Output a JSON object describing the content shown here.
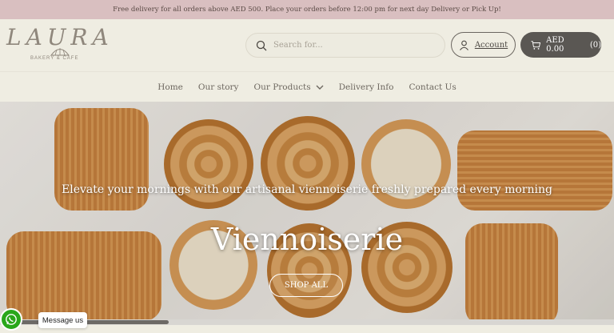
{
  "announcement": "Free delivery for all orders above AED 500. Place your orders before 12:00 pm for next day Delivery or Pick Up!",
  "logo": {
    "word": "LAURA",
    "sub": "BAKERY & CAFE"
  },
  "search": {
    "placeholder": "Search for..."
  },
  "account": {
    "label": "Account"
  },
  "cart": {
    "amount": "AED 0.00",
    "count": "(0)"
  },
  "nav": [
    {
      "label": "Home"
    },
    {
      "label": "Our story"
    },
    {
      "label": "Our Products"
    },
    {
      "label": "Delivery Info"
    },
    {
      "label": "Contact Us"
    }
  ],
  "hero": {
    "subtitle": "Elevate your mornings with our artisanal viennoiserie freshly prepared every morning",
    "title": "Viennoiserie",
    "button": "SHOP ALL"
  },
  "chat": {
    "label": "Message us"
  },
  "colors": {
    "announcement_bg": "#d9bfc0",
    "cart_bg": "#5a5753",
    "whatsapp": "#29a71a"
  },
  "icons": [
    "search-icon",
    "user-icon",
    "cart-icon",
    "chevron-down-icon",
    "whatsapp-icon",
    "croissant-icon"
  ]
}
